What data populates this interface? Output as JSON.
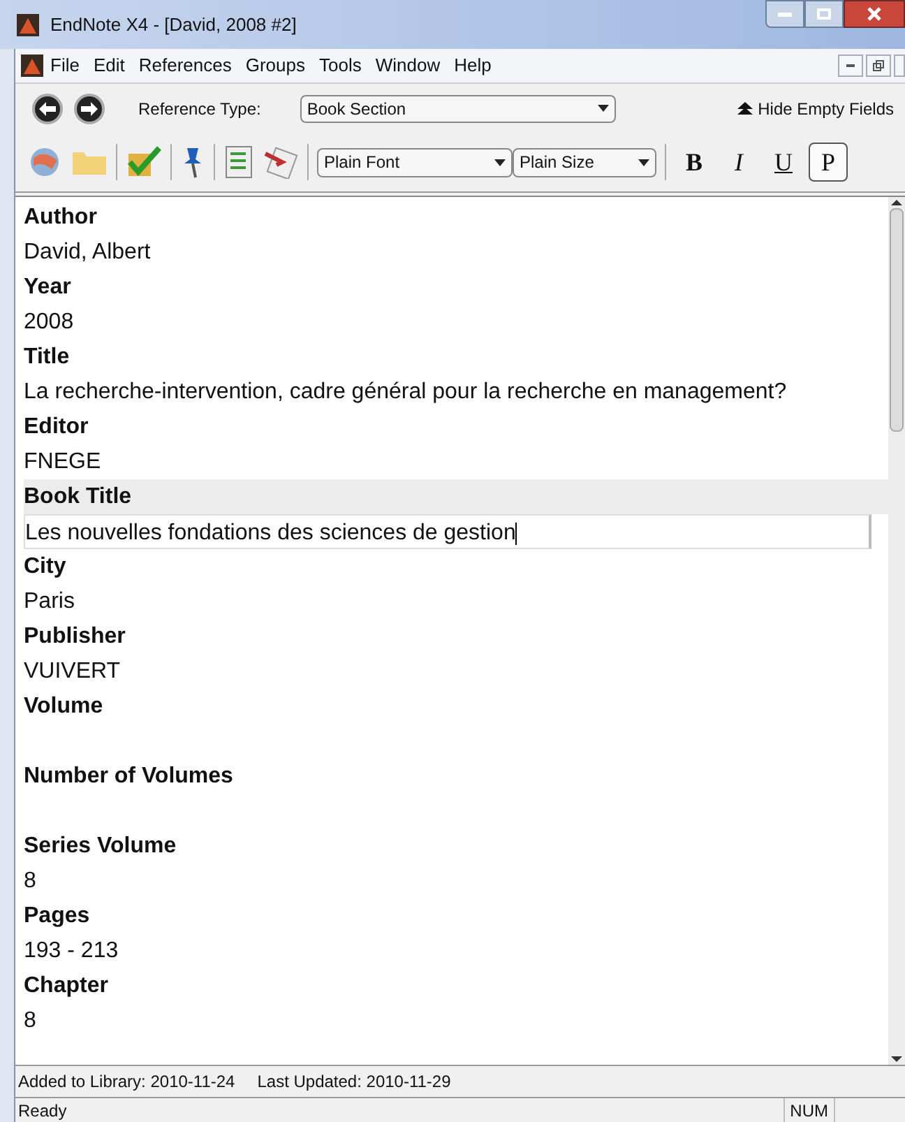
{
  "window": {
    "title": "EndNote X4 - [David, 2008 #2]"
  },
  "menu": [
    "File",
    "Edit",
    "References",
    "Groups",
    "Tools",
    "Window",
    "Help"
  ],
  "reference_type": {
    "label": "Reference Type:",
    "value": "Book Section"
  },
  "hide_empty": "Hide Empty Fields",
  "font": "Plain Font",
  "size": "Plain Size",
  "format_buttons": [
    {
      "label": "B",
      "kind": "bold",
      "selected": false
    },
    {
      "label": "I",
      "kind": "italic",
      "selected": false
    },
    {
      "label": "U",
      "kind": "underline",
      "selected": false
    },
    {
      "label": "P",
      "kind": "plain",
      "selected": true
    }
  ],
  "fields": [
    {
      "label": "Author",
      "value": "David, Albert",
      "selected": false
    },
    {
      "label": "Year",
      "value": "2008",
      "selected": false
    },
    {
      "label": "Title",
      "value": "La recherche-intervention, cadre général pour la recherche en management?",
      "selected": false
    },
    {
      "label": "Editor",
      "value": "FNEGE",
      "selected": false
    },
    {
      "label": "Book Title",
      "value": "Les nouvelles fondations des sciences de gestion",
      "selected": true
    },
    {
      "label": "City",
      "value": "Paris",
      "selected": false
    },
    {
      "label": "Publisher",
      "value": "VUIVERT",
      "selected": false
    },
    {
      "label": "Volume",
      "selected": false
    },
    {
      "label": "Number of Volumes",
      "selected": false
    },
    {
      "label": "Series Volume",
      "value": "8",
      "selected": false
    },
    {
      "label": "Pages",
      "value": "193 - 213",
      "selected": false
    },
    {
      "label": "Chapter",
      "value": "8",
      "selected": false
    }
  ],
  "info_line": {
    "added": "Added to Library: 2010-11-24",
    "updated": "Last Updated: 2010-11-29"
  },
  "status_bar": {
    "text": "Ready",
    "num": "NUM"
  }
}
